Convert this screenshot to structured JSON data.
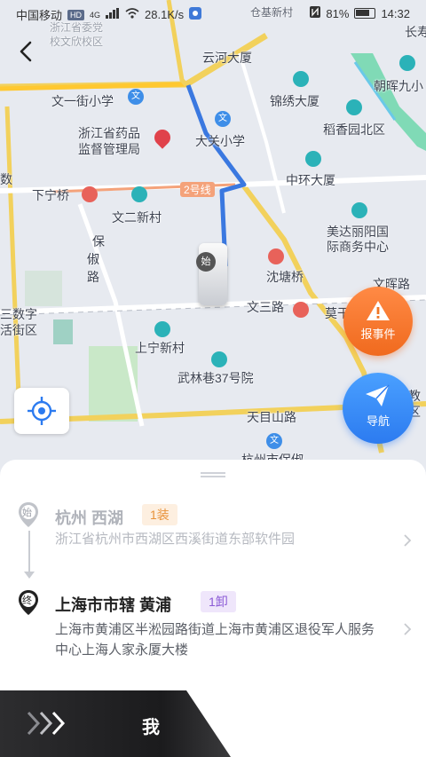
{
  "status_bar": {
    "carrier": "中国移动",
    "hd": "HD",
    "signal": "4G",
    "speed": "28.1K/s",
    "battery_percent": "81%",
    "time": "14:32"
  },
  "map": {
    "labels": {
      "zjsww": "浙江省委党",
      "zjsww2": "校文欣校区",
      "cangji": "仓基新村",
      "yunhe": "云河大厦",
      "changshou": "长寿",
      "wenyi": "文一街小学",
      "jinxiu": "锦绣大厦",
      "chaohui": "朝晖九小",
      "daoxiang": "稻香园北区",
      "zjyp1": "浙江省药品",
      "zjyp2": "监督管理局",
      "daguan": "大关小学",
      "zhonghuan": "中环大厦",
      "xianing": "下宁桥",
      "line2": "2号线",
      "wener": "文二新村",
      "meida1": "美达丽阳国",
      "meida2": "际商务中心",
      "baoshu1": "保",
      "baoshu2": "俶",
      "baoshu3": "路",
      "shentang": "沈塘桥",
      "wensan": "文三路",
      "sanshuzi1": "三数字",
      "sanshuzi2": "活街区",
      "wenhui": "文晖路",
      "moganshan": "莫干山路",
      "shangning": "上宁新村",
      "wulin": "武林巷37号院",
      "tianmushan": "天目山路",
      "hangzhou": "杭州市保俶",
      "jiao": "教",
      "jiaoming": "区",
      "shu": "数"
    },
    "start_badge": "始"
  },
  "buttons": {
    "report_label": "报事件",
    "nav_label": "导航"
  },
  "route": {
    "origin": {
      "badge": "始",
      "title": "杭州 西湖",
      "tag": "1装",
      "address": "浙江省杭州市西湖区西溪街道东部软件园"
    },
    "destination": {
      "badge": "终",
      "title": "上海市市辖 黄浦",
      "tag": "1卸",
      "address": "上海市黄浦区半淞园路街道上海市黄浦区退役军人服务中心上海人家永厦大楼"
    }
  },
  "slider": {
    "label": "我"
  },
  "colors": {
    "route_blue": "#3a78e0",
    "report_orange": "#f06a1e",
    "nav_blue": "#2c7bf0",
    "origin_tag": "#e8923a",
    "dest_tag": "#8b5ad6"
  }
}
